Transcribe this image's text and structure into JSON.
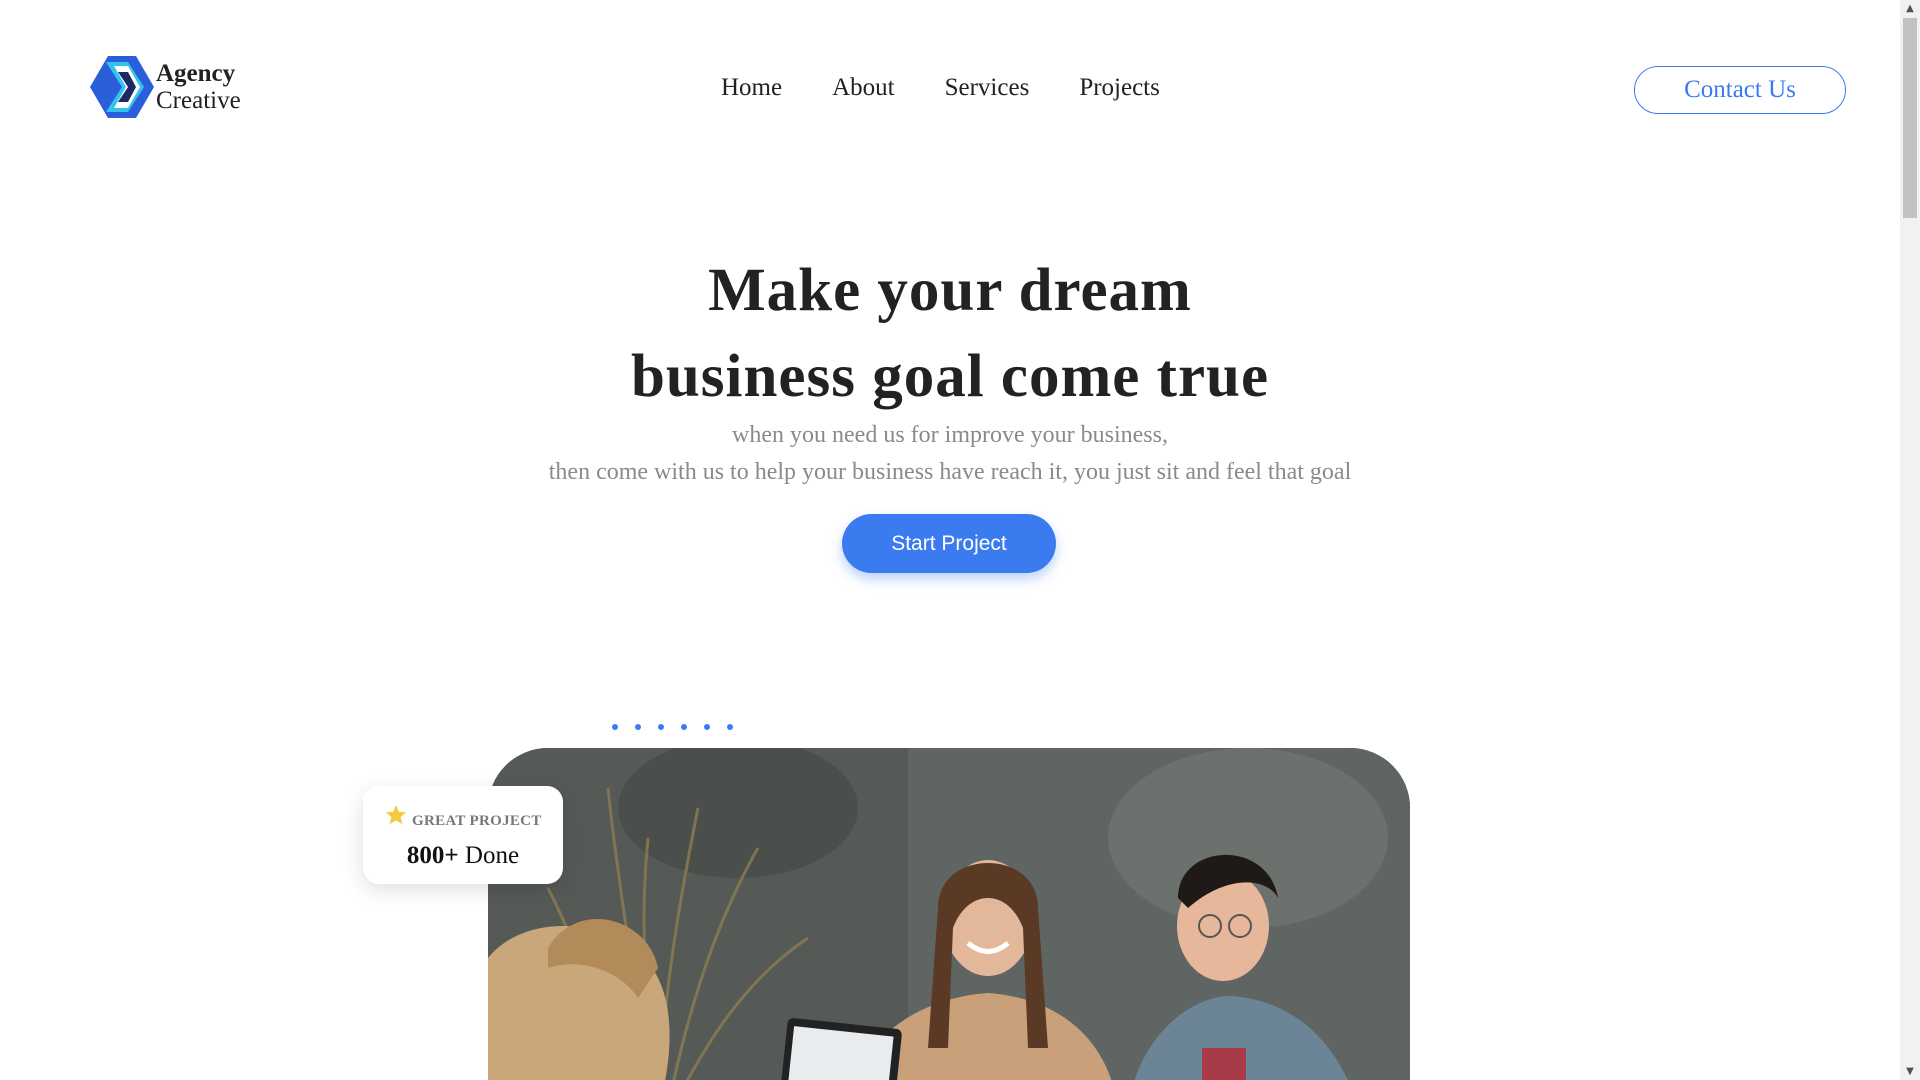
{
  "logo": {
    "line1": "Agency",
    "line2": "Creative"
  },
  "nav": {
    "items": [
      "Home",
      "About",
      "Services",
      "Projects"
    ]
  },
  "header": {
    "contact_label": "Contact Us"
  },
  "hero": {
    "title_line1": "Make your dream",
    "title_line2": "business goal come true",
    "subtitle_line1": "when you need us for improve your business,",
    "subtitle_line2": "then come with us to help your business have reach it, you just sit and feel that goal",
    "cta_label": "Start Project"
  },
  "badge": {
    "label": "GREAT PROJECT",
    "number": "800+",
    "suffix": "Done"
  },
  "colors": {
    "accent": "#3b7bf0",
    "star": "#f5c842",
    "text": "#1e1e1e",
    "muted": "#8a8a8a"
  },
  "icons": {
    "logo": "agency-logo-icon",
    "badge": "star-icon"
  }
}
